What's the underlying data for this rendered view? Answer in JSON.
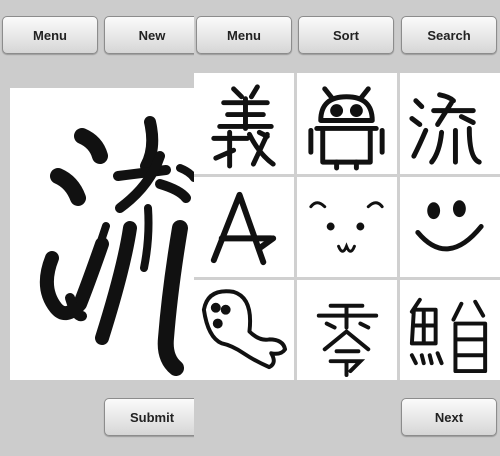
{
  "left_panel": {
    "menu_label": "Menu",
    "new_label": "New",
    "submit_label": "Submit"
  },
  "right_panel": {
    "menu_label": "Menu",
    "sort_label": "Sort",
    "search_label": "Search",
    "next_label": "Next"
  },
  "gallery": [
    {
      "name": "kanji-gi-drawing"
    },
    {
      "name": "robot-drawing"
    },
    {
      "name": "kanji-ryu-drawing"
    },
    {
      "name": "letter-a-drawing"
    },
    {
      "name": "bear-face-drawing"
    },
    {
      "name": "smiley-face-drawing"
    },
    {
      "name": "ghost-drawing"
    },
    {
      "name": "kanji-rei-drawing"
    },
    {
      "name": "kanji-tuna-drawing"
    }
  ]
}
